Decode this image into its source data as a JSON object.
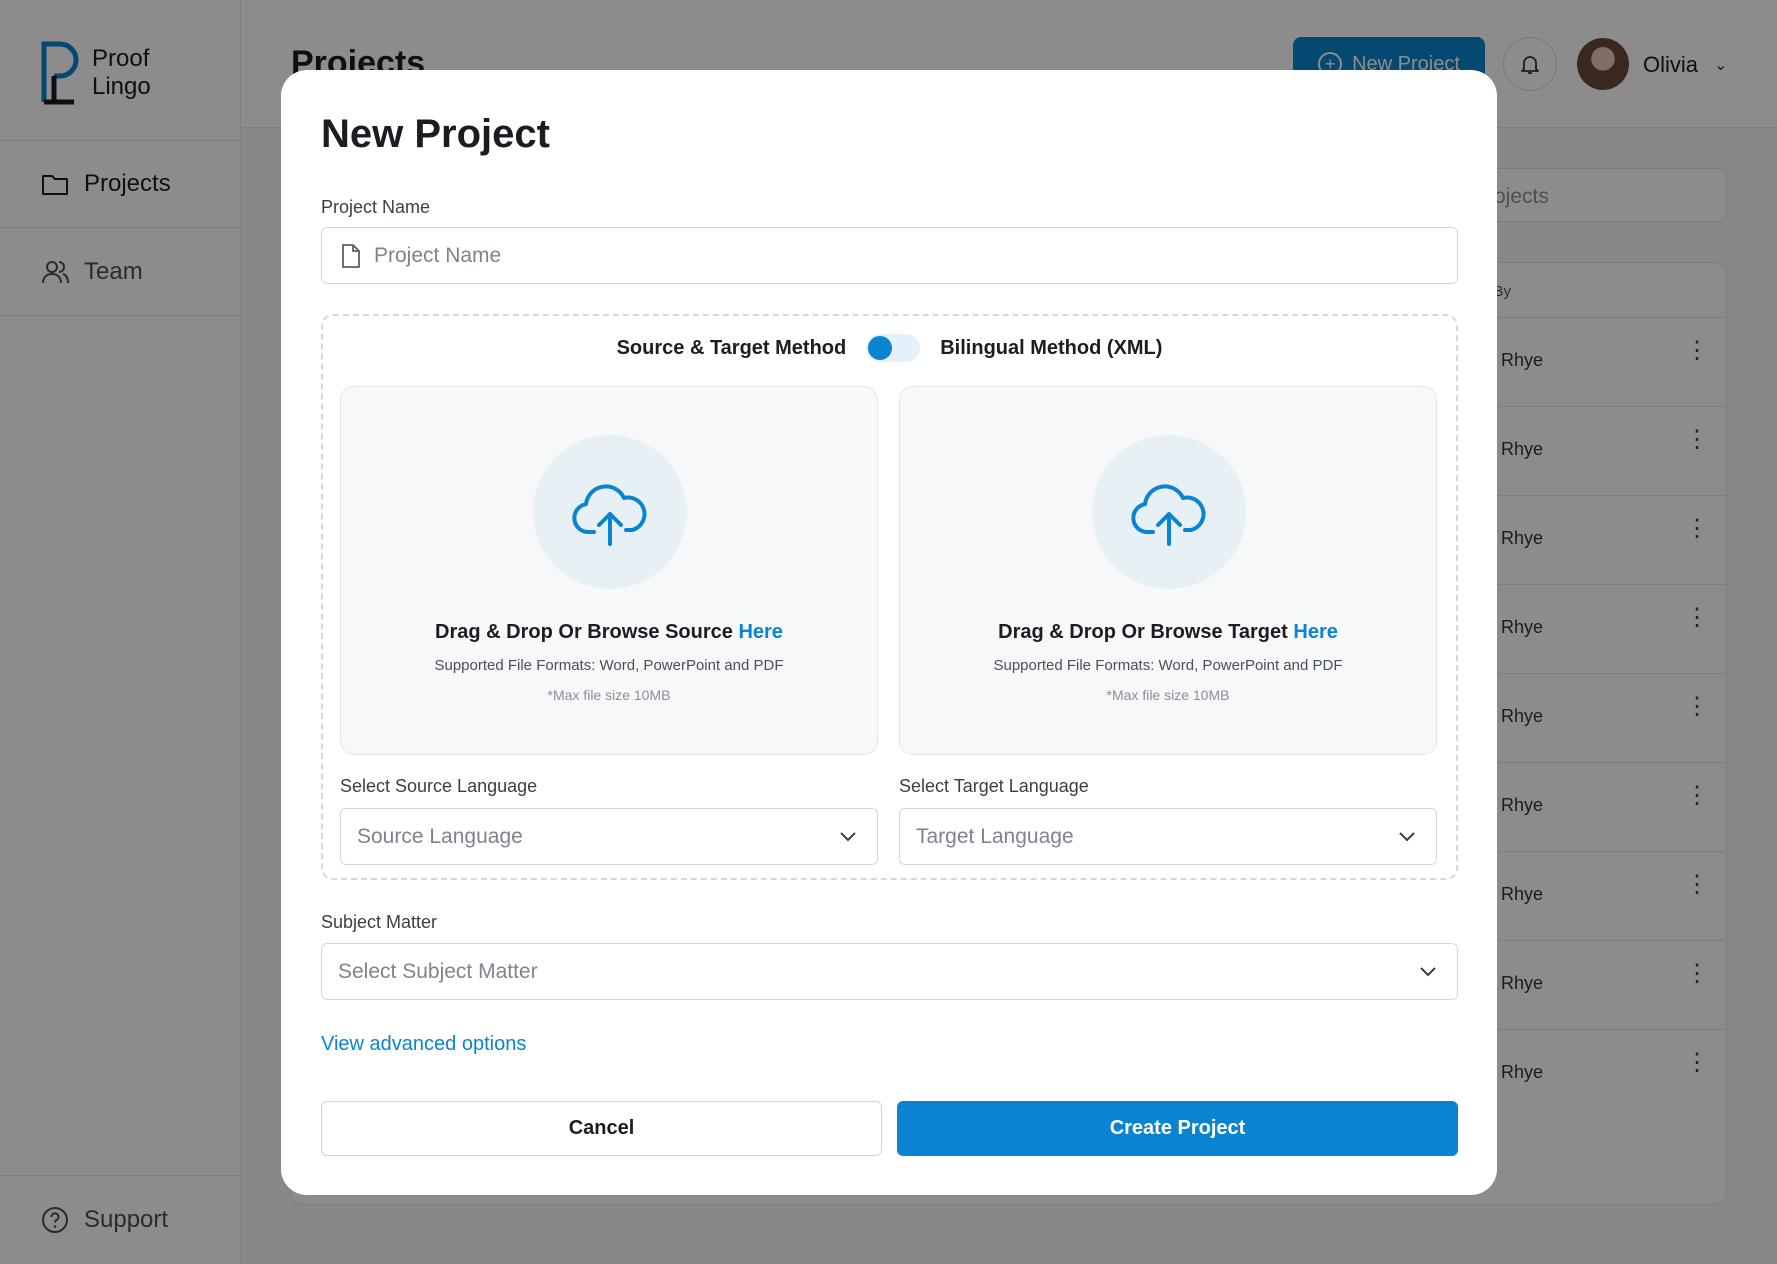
{
  "app": {
    "logo_line1": "Proof",
    "logo_line2": "Lingo",
    "accent_color": "#0a84d0"
  },
  "sidebar": {
    "items": [
      {
        "label": "Projects",
        "icon": "folder-icon"
      },
      {
        "label": "Team",
        "icon": "users-icon"
      }
    ],
    "support_label": "Support"
  },
  "header": {
    "title": "Projects",
    "new_project_label": "New Project",
    "user_name": "Olivia"
  },
  "background": {
    "search_placeholder_visible": "ojects",
    "column_header_fragment": "d By",
    "rows": [
      "Rhye",
      "Rhye",
      "Rhye",
      "Rhye",
      "Rhye",
      "Rhye",
      "Rhye",
      "Rhye",
      "Rhye"
    ]
  },
  "modal": {
    "title": "New Project",
    "project_name": {
      "label": "Project Name",
      "placeholder": "Project Name"
    },
    "method": {
      "left": "Source & Target Method",
      "right": "Bilingual Method (XML)"
    },
    "source_drop": {
      "title": "Drag & Drop Or Browse Source",
      "link": "Here",
      "formats": "Supported File Formats: Word, PowerPoint and PDF",
      "max": "*Max file size 10MB"
    },
    "target_drop": {
      "title": "Drag & Drop Or Browse Target",
      "link": "Here",
      "formats": "Supported File Formats: Word, PowerPoint and PDF",
      "max": "*Max file size 10MB"
    },
    "source_language": {
      "label": "Select Source Language",
      "placeholder": "Source Language"
    },
    "target_language": {
      "label": "Select Target Language",
      "placeholder": "Target Language"
    },
    "subject": {
      "label": "Subject Matter",
      "placeholder": "Select Subject Matter"
    },
    "advanced_link": "View advanced options",
    "cancel_label": "Cancel",
    "create_label": "Create Project"
  }
}
